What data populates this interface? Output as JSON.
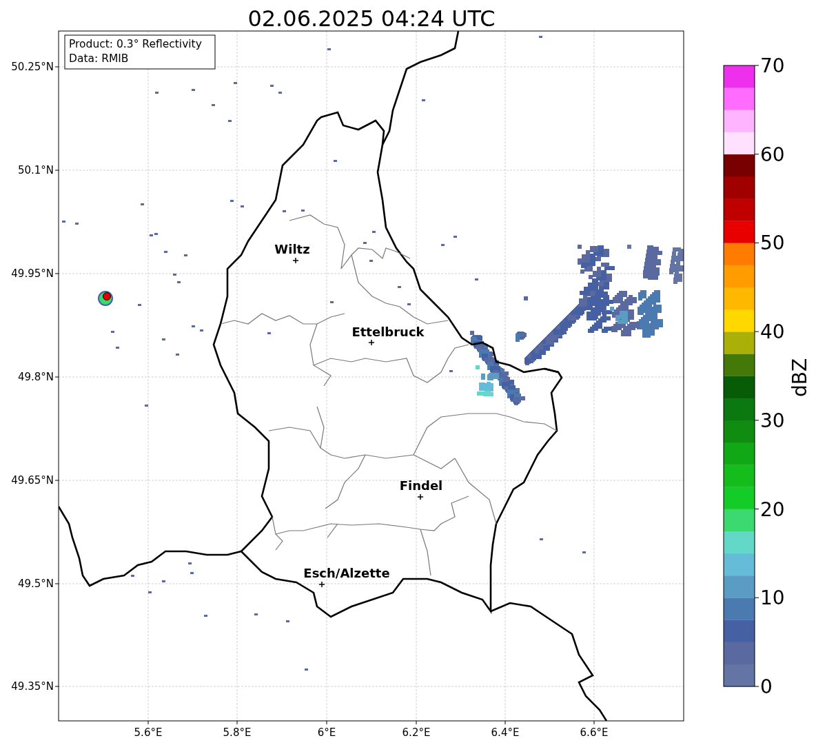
{
  "title": "02.06.2025 04:24 UTC",
  "info_box": {
    "lines": [
      "Product: 0.3° Reflectivity",
      "Data: RMIB"
    ]
  },
  "map": {
    "y_ticks": [
      "50.25°N",
      "50.1°N",
      "49.95°N",
      "49.8°N",
      "49.65°N",
      "49.5°N",
      "49.35°N"
    ],
    "x_ticks": [
      "5.6°E",
      "5.8°E",
      "6°E",
      "6.2°E",
      "6.4°E",
      "6.6°E"
    ],
    "places": [
      {
        "name": "Wiltz"
      },
      {
        "name": "Ettelbruck"
      },
      {
        "name": "Findel"
      },
      {
        "name": "Esch/Alzette"
      }
    ]
  },
  "colorbar": {
    "label": "dBZ",
    "ticks": [
      "70",
      "60",
      "50",
      "40",
      "30",
      "20",
      "10",
      "0"
    ],
    "bands": [
      {
        "color": "#6474a4"
      },
      {
        "color": "#5a6aa0"
      },
      {
        "color": "#4660a4"
      },
      {
        "color": "#4b7ab0"
      },
      {
        "color": "#5a9cc4"
      },
      {
        "color": "#64bcd8"
      },
      {
        "color": "#64d8c8"
      },
      {
        "color": "#3cd870"
      },
      {
        "color": "#14cc28"
      },
      {
        "color": "#14bc1c"
      },
      {
        "color": "#10a814"
      },
      {
        "color": "#108c10"
      },
      {
        "color": "#0c7810"
      },
      {
        "color": "#085c08"
      },
      {
        "color": "#447808"
      },
      {
        "color": "#aab008"
      },
      {
        "color": "#ffd800"
      },
      {
        "color": "#ffb800"
      },
      {
        "color": "#ff9c00"
      },
      {
        "color": "#ff7c00"
      },
      {
        "color": "#e80000"
      },
      {
        "color": "#c00000"
      },
      {
        "color": "#a00000"
      },
      {
        "color": "#780000"
      },
      {
        "color": "#ffe0ff"
      },
      {
        "color": "#ffb4ff"
      },
      {
        "color": "#ff6cff"
      },
      {
        "color": "#ee30ee"
      }
    ]
  }
}
